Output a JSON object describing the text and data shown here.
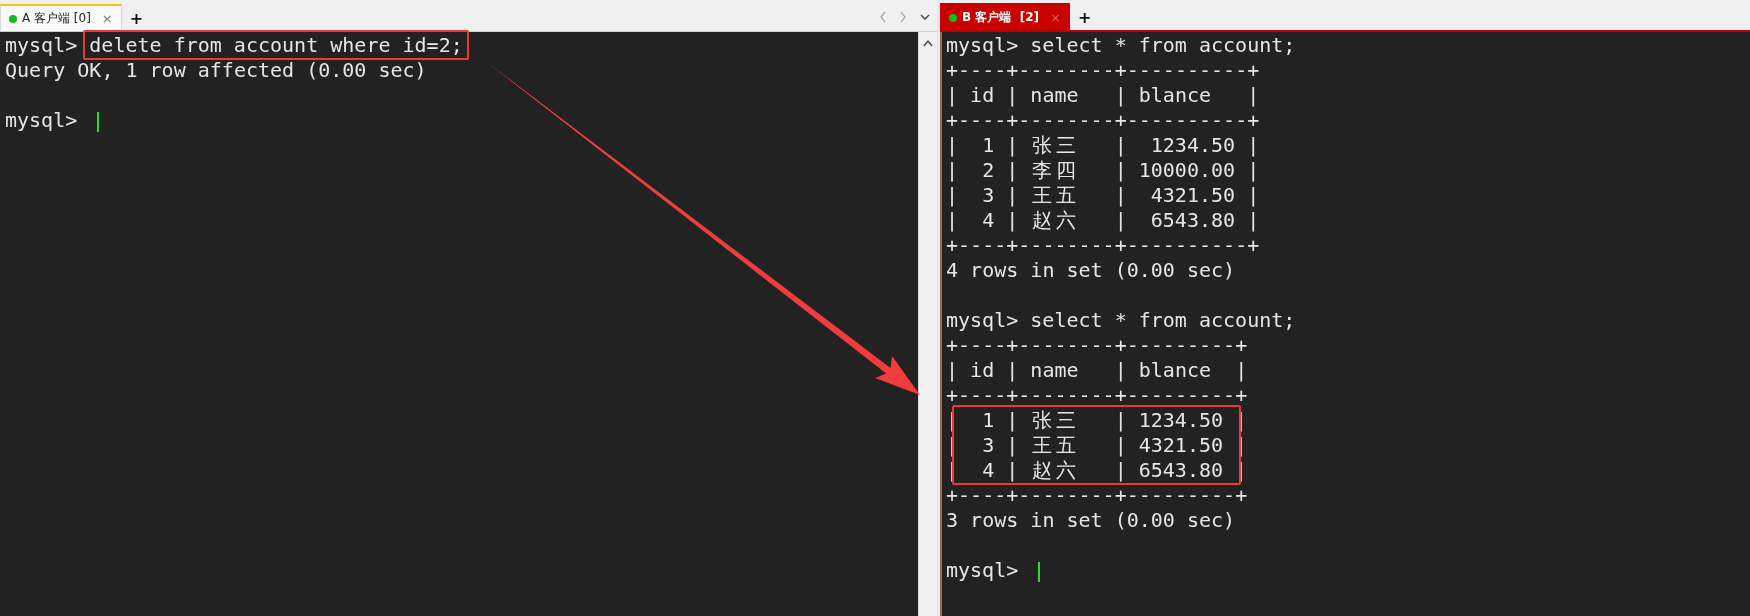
{
  "panes": [
    {
      "tab": {
        "label": "A 客户端 [0]",
        "selected": false,
        "close": "×"
      },
      "new_tab": "+",
      "tab_nav": true,
      "cursor": true,
      "lines": [
        {
          "kind": "prompt",
          "prompt": "mysql>",
          "text": "delete from account where id=2;",
          "highlighted": true
        },
        {
          "kind": "output",
          "text": "Query OK, 1 row affected (0.00 sec)"
        },
        {
          "kind": "blank"
        },
        {
          "kind": "prompt",
          "prompt": "mysql>"
        }
      ]
    },
    {
      "tab": {
        "label": "B 客户端  [2]",
        "selected": true,
        "close": "×"
      },
      "new_tab": "+",
      "tab_nav": false,
      "cursor": true,
      "lines": [
        {
          "kind": "prompt",
          "prompt": "mysql>",
          "text": "select * from account;"
        },
        {
          "kind": "output",
          "text": "+----+--------+----------+"
        },
        {
          "kind": "output",
          "text": "| id | name   | blance   |"
        },
        {
          "kind": "output",
          "text": "+----+--------+----------+"
        },
        {
          "kind": "output",
          "text": "|  1 | 张三   |  1234.50 |"
        },
        {
          "kind": "output",
          "text": "|  2 | 李四   | 10000.00 |"
        },
        {
          "kind": "output",
          "text": "|  3 | 王五   |  4321.50 |"
        },
        {
          "kind": "output",
          "text": "|  4 | 赵六   |  6543.80 |"
        },
        {
          "kind": "output",
          "text": "+----+--------+----------+"
        },
        {
          "kind": "output",
          "text": "4 rows in set (0.00 sec)"
        },
        {
          "kind": "blank"
        },
        {
          "kind": "prompt",
          "prompt": "mysql>",
          "text": "select * from account;"
        },
        {
          "kind": "output",
          "text": "+----+--------+---------+"
        },
        {
          "kind": "output",
          "text": "| id | name   | blance  |"
        },
        {
          "kind": "output",
          "text": "+----+--------+---------+"
        },
        {
          "kind": "output",
          "text": "|  1 | 张三   | 1234.50 |",
          "highlighted": true
        },
        {
          "kind": "output",
          "text": "|  3 | 王五   | 4321.50 |",
          "highlighted": true
        },
        {
          "kind": "output",
          "text": "|  4 | 赵六   | 6543.80 |",
          "highlighted": true
        },
        {
          "kind": "output",
          "text": "+----+--------+---------+"
        },
        {
          "kind": "output",
          "text": "3 rows in set (0.00 sec)"
        },
        {
          "kind": "blank"
        },
        {
          "kind": "prompt",
          "prompt": "mysql>"
        }
      ]
    }
  ],
  "annotation_arrow": true
}
